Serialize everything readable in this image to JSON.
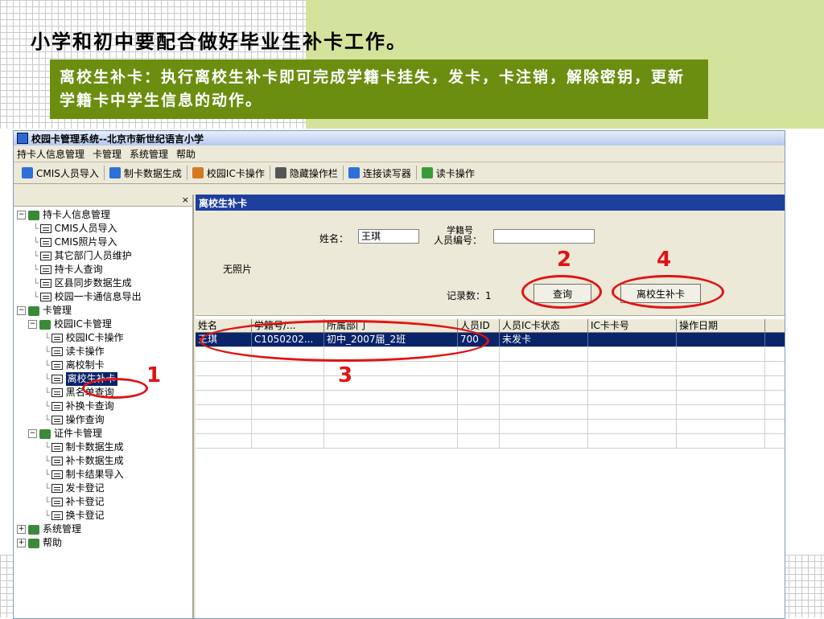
{
  "slide": {
    "title": "小学和初中要配合做好毕业生补卡工作。",
    "callout": "离校生补卡：执行离校生补卡即可完成学籍卡挂失，发卡，卡注销，解除密钥，更新学籍卡中学生信息的动作。"
  },
  "window": {
    "title": "校园卡管理系统--北京市新世纪语言小学",
    "menu": [
      "持卡人信息管理",
      "卡管理",
      "系统管理",
      "帮助"
    ],
    "toolbar": [
      {
        "label": "CMIS人员导入",
        "icon": "import-icon",
        "color": "#2f6fd8"
      },
      {
        "label": "制卡数据生成",
        "icon": "generate-icon",
        "color": "#2f6fd8"
      },
      {
        "label": "校园IC卡操作",
        "icon": "card-icon",
        "color": "#d47a1e"
      },
      {
        "label": "隐藏操作栏",
        "icon": "hide-panel-icon",
        "color": "#555555"
      },
      {
        "label": "连接读写器",
        "icon": "reader-icon",
        "color": "#2f6fd8"
      },
      {
        "label": "读卡操作",
        "icon": "read-card-icon",
        "color": "#3a9a3a"
      }
    ]
  },
  "tree": {
    "close": "×",
    "root1": "持卡人信息管理",
    "root1_items": [
      "CMIS人员导入",
      "CMIS照片导入",
      "其它部门人员维护",
      "持卡人查询",
      "区县同步数据生成",
      "校园一卡通信息导出"
    ],
    "root2": "卡管理",
    "sub1": "校园IC卡管理",
    "sub1_items": [
      "校园IC卡操作",
      "读卡操作",
      "离校制卡",
      "离校生补卡",
      "黑名单查询",
      "补换卡查询",
      "操作查询"
    ],
    "sub2": "证件卡管理",
    "sub2_items": [
      "制卡数据生成",
      "补卡数据生成",
      "制卡结果导入",
      "发卡登记",
      "补卡登记",
      "换卡登记"
    ],
    "root3": "系统管理",
    "root4": "帮助"
  },
  "form": {
    "header": "离校生补卡",
    "name_label": "姓名：",
    "name_value": "王琪",
    "id_label_top": "学籍号",
    "id_label_bottom": "人员编号：",
    "id_value": "",
    "no_photo": "无照片",
    "count_label": "记录数：1",
    "query_button": "查询",
    "reissue_button": "离校生补卡"
  },
  "grid": {
    "columns": [
      "姓名",
      "学籍号/...",
      "所属部门",
      "人员ID",
      "人员IC卡状态",
      "IC卡卡号",
      "操作日期"
    ],
    "rows": [
      [
        "王琪",
        "C1050202...",
        "初中_2007届_2班",
        "700",
        "未发卡",
        "",
        ""
      ]
    ]
  },
  "annotations": {
    "n1": "1",
    "n2": "2",
    "n3": "3",
    "n4": "4",
    "color": "#e01414"
  }
}
